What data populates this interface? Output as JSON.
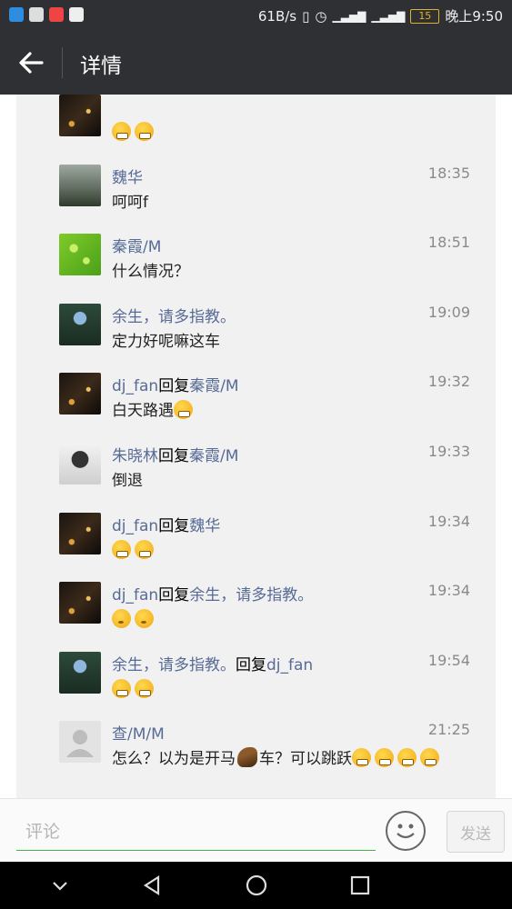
{
  "status_bar": {
    "speed": "61B/s",
    "battery": "15",
    "time": "晚上9:50",
    "icons": [
      "notification-icon",
      "alert-icon",
      "mail-icon",
      "sina-icon",
      "vibrate-icon",
      "alarm-icon",
      "4g-signal-icon",
      "3g-signal-icon",
      "battery-icon"
    ]
  },
  "header": {
    "title": "详情"
  },
  "comments": [
    {
      "name": "",
      "time": "",
      "text": "",
      "emojis": [
        "grin",
        "grin"
      ],
      "avatar": "city"
    },
    {
      "name": "魏华",
      "time": "18:35",
      "text": "呵呵f",
      "emojis": [],
      "avatar": "tree"
    },
    {
      "name": "秦霞/M",
      "time": "18:51",
      "text": "什么情况？",
      "emojis": [],
      "avatar": "drops"
    },
    {
      "name": "余生，请多指教。",
      "time": "19:09",
      "text": "定力好呢嘛这车",
      "emojis": [],
      "avatar": "robot"
    },
    {
      "name": "dj_fan",
      "reply_label": "回复",
      "reply_to": "秦霞/M",
      "time": "19:32",
      "text": "白天路遇",
      "emojis": [
        "grin"
      ],
      "avatar": "city"
    },
    {
      "name": "朱晓林",
      "reply_label": "回复",
      "reply_to": "秦霞/M",
      "time": "19:33",
      "text": "倒退",
      "emojis": [],
      "avatar": "person"
    },
    {
      "name": "dj_fan",
      "reply_label": "回复",
      "reply_to": "魏华",
      "time": "19:34",
      "text": "",
      "emojis": [
        "grin",
        "grin"
      ],
      "avatar": "city"
    },
    {
      "name": "dj_fan",
      "reply_label": "回复",
      "reply_to": "余生，请多指教。",
      "time": "19:34",
      "text": "",
      "emojis": [
        "think",
        "think"
      ],
      "avatar": "city"
    },
    {
      "name": "余生，请多指教。",
      "reply_label": "回复",
      "reply_to": "dj_fan",
      "time": "19:54",
      "text": "",
      "emojis": [
        "grin",
        "grin"
      ],
      "avatar": "robot"
    },
    {
      "name": "查/M/M",
      "time": "21:25",
      "text_before": "怎么？以为是开马",
      "text_after": "车？可以跳跃",
      "emojis": [
        "grin",
        "grin",
        "grin",
        "grin"
      ],
      "avatar": "default"
    }
  ],
  "composer": {
    "placeholder": "评论",
    "send_label": "发送"
  },
  "colors": {
    "bar": "#2f3033",
    "name": "#576b95",
    "accent": "#46b04a",
    "panel": "#f1f1f2"
  }
}
